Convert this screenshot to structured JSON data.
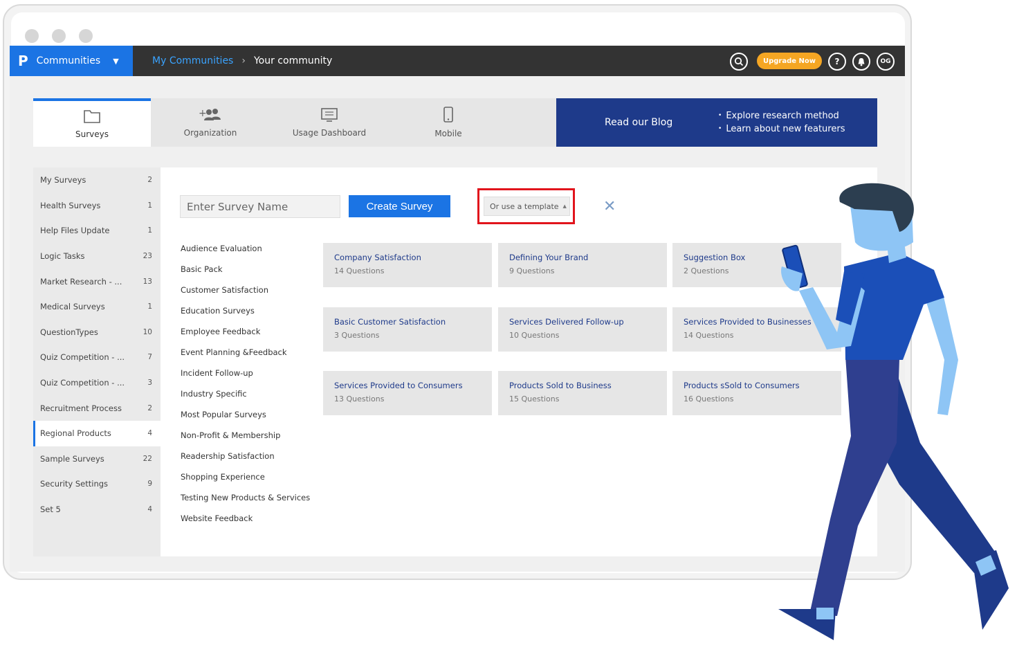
{
  "topbar": {
    "brand_logo": "P",
    "brand_name": "Communities",
    "breadcrumb_link": "My Communities",
    "breadcrumb_current": "Your community",
    "upgrade_label": "Upgrade Now",
    "user_initials": "OG",
    "help_symbol": "?"
  },
  "tabs": [
    {
      "label": "Surveys",
      "icon": "folder-icon",
      "active": true
    },
    {
      "label": "Organization",
      "icon": "add-users-icon"
    },
    {
      "label": "Usage Dashboard",
      "icon": "monitor-icon"
    },
    {
      "label": "Mobile",
      "icon": "mobile-icon"
    }
  ],
  "blog": {
    "title": "Read our Blog",
    "bullets": [
      "Explore research method",
      "Learn about new featurers"
    ]
  },
  "sidebar": {
    "items": [
      {
        "label": "My Surveys",
        "count": "2"
      },
      {
        "label": "Health Surveys",
        "count": "1"
      },
      {
        "label": "Help Files Update",
        "count": "1"
      },
      {
        "label": "Logic Tasks",
        "count": "23"
      },
      {
        "label": "Market Research - ...",
        "count": "13"
      },
      {
        "label": "Medical Surveys",
        "count": "1"
      },
      {
        "label": "QuestionTypes",
        "count": "10"
      },
      {
        "label": "Quiz Competition - ...",
        "count": "7"
      },
      {
        "label": "Quiz Competition - ...",
        "count": "3"
      },
      {
        "label": "Recruitment Process",
        "count": "2"
      },
      {
        "label": "Regional Products",
        "count": "4",
        "active": true
      },
      {
        "label": "Sample Surveys",
        "count": "22"
      },
      {
        "label": "Security Settings",
        "count": "9"
      },
      {
        "label": "Set 5",
        "count": "4"
      }
    ]
  },
  "create": {
    "placeholder": "Enter Survey Name",
    "button_label": "Create Survey",
    "template_label": "Or use a template"
  },
  "categories": [
    "Audience Evaluation",
    "Basic Pack",
    "Customer Satisfaction",
    "Education Surveys",
    "Employee Feedback",
    "Event Planning &Feedback",
    "Incident Follow-up",
    "Industry Specific",
    "Most Popular Surveys",
    "Non-Profit & Membership",
    "Readership Satisfaction",
    "Shopping Experience",
    "Testing New Products & Services",
    "Website Feedback"
  ],
  "templates": [
    {
      "title": "Company Satisfaction",
      "questions": "14 Questions"
    },
    {
      "title": "Defining Your Brand",
      "questions": "9 Questions"
    },
    {
      "title": "Suggestion Box",
      "questions": "2 Questions"
    },
    {
      "title": "Basic Customer Satisfaction",
      "questions": "3 Questions"
    },
    {
      "title": "Services Delivered Follow-up",
      "questions": "10 Questions"
    },
    {
      "title": "Services Provided to Businesses",
      "questions": "14 Questions"
    },
    {
      "title": "Services Provided to Consumers",
      "questions": "13 Questions"
    },
    {
      "title": "Products Sold to Business",
      "questions": "15 Questions"
    },
    {
      "title": "Products sSold to Consumers",
      "questions": "16 Questions"
    }
  ],
  "colors": {
    "accent": "#1b74e4",
    "topbar": "#333333",
    "blog": "#1e3a8a",
    "upgrade": "#f5a623",
    "highlight": "#e1141c"
  }
}
